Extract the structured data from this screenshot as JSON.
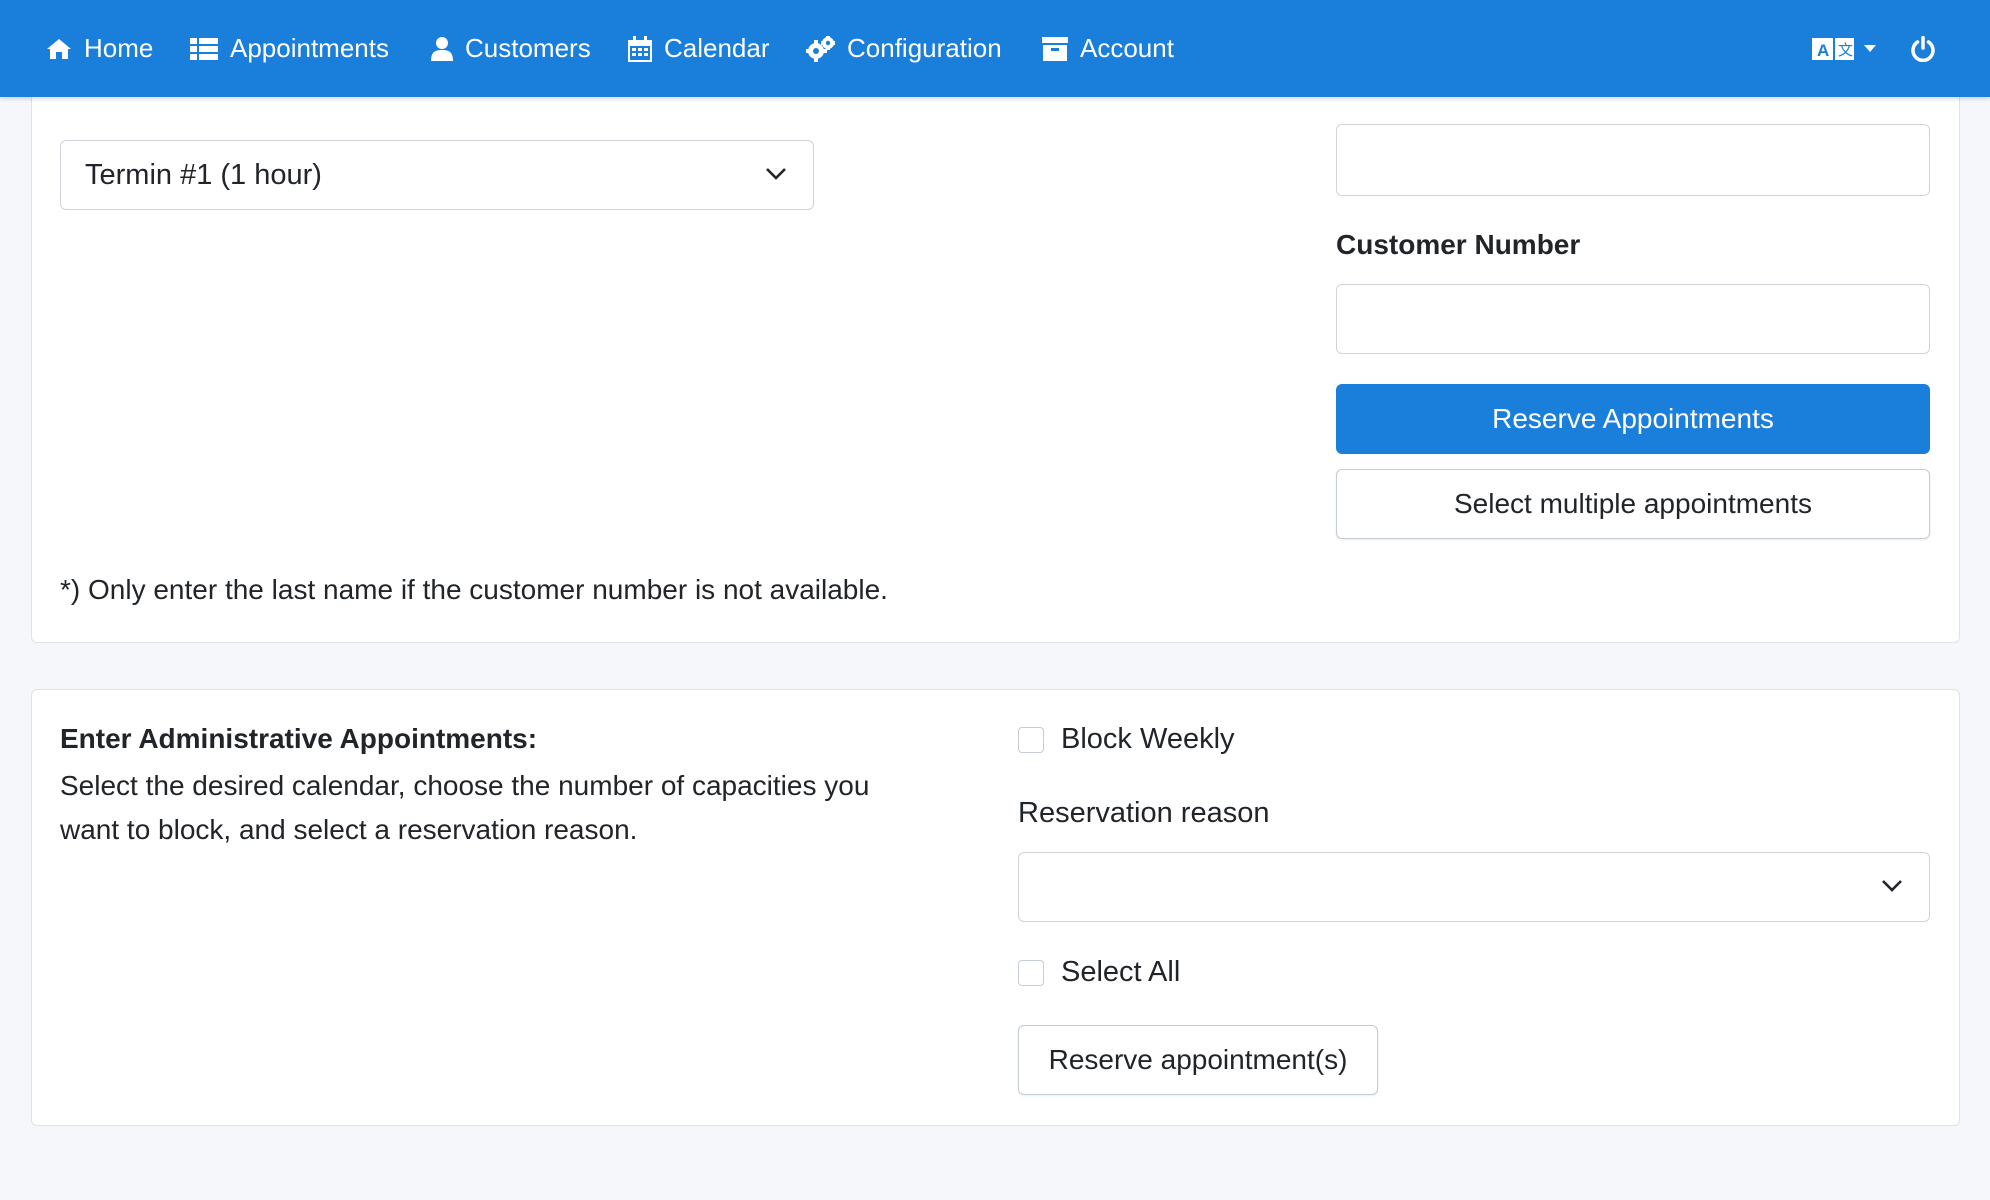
{
  "nav": {
    "items": [
      {
        "label": "Home",
        "icon": "home-icon"
      },
      {
        "label": "Appointments",
        "icon": "list-icon"
      },
      {
        "label": "Customers",
        "icon": "user-icon"
      },
      {
        "label": "Calendar",
        "icon": "calendar-icon"
      },
      {
        "label": "Configuration",
        "icon": "gears-icon"
      },
      {
        "label": "Account",
        "icon": "archive-icon"
      }
    ],
    "language_icon": "translate-icon",
    "power_icon": "power-icon",
    "bar_color": "#1a7edb"
  },
  "reservation": {
    "appointment_type_selected": "Termin #1 (1 hour)",
    "last_name_value": "",
    "customer_number_label": "Customer Number",
    "customer_number_value": "",
    "reserve_button": "Reserve Appointments",
    "select_multiple_button": "Select multiple appointments",
    "footnote": "*) Only enter the last name if the customer number is not available."
  },
  "admin": {
    "heading": "Enter Administrative Appointments:",
    "description_line1": "Select the desired calendar, choose the number of capacities you",
    "description_line2": "want to block, and select a reservation reason.",
    "block_weekly_label": "Block Weekly",
    "block_weekly_checked": false,
    "reason_label": "Reservation reason",
    "reason_selected": "",
    "select_all_label": "Select All",
    "select_all_checked": false,
    "reserve_button": "Reserve appointment(s)"
  }
}
